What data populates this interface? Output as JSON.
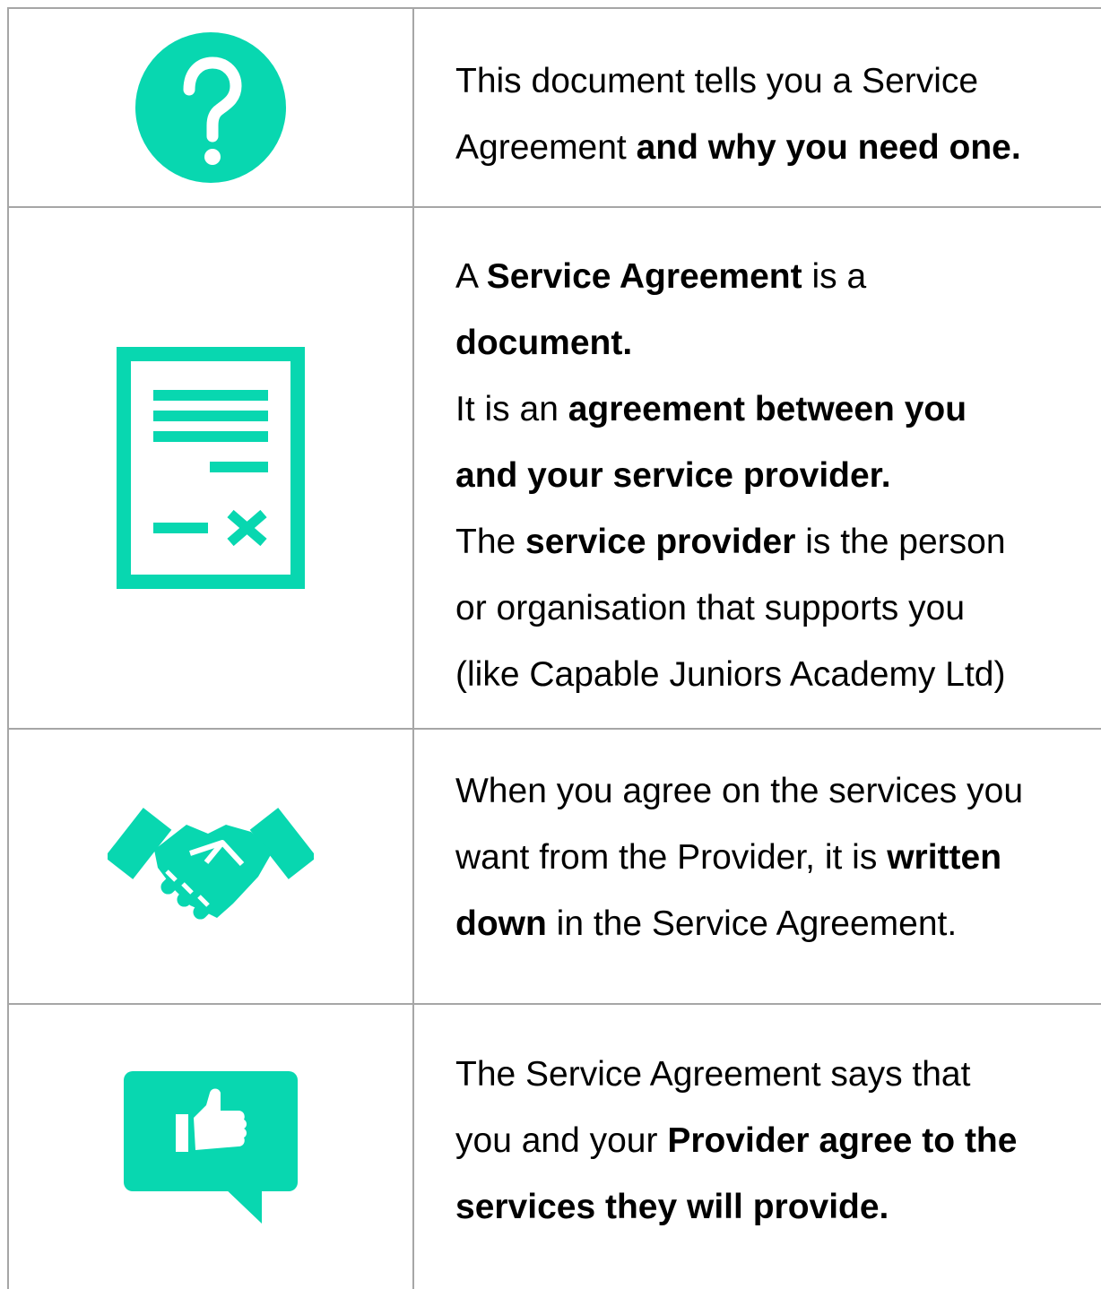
{
  "accent_color": "#08d7b0",
  "rows": [
    {
      "icon": "question-mark-icon",
      "lines": [
        [
          {
            "t": "This document tells you a Service",
            "b": false
          }
        ],
        [
          {
            "t": "Agreement ",
            "b": false
          },
          {
            "t": "and why you need one.",
            "b": true
          }
        ]
      ]
    },
    {
      "icon": "document-sign-icon",
      "lines": [
        [
          {
            "t": "A ",
            "b": false
          },
          {
            "t": "Service Agreement",
            "b": true
          },
          {
            "t": " is a",
            "b": false
          }
        ],
        [
          {
            "t": "document.",
            "b": true
          }
        ],
        [
          {
            "t": "It is an ",
            "b": false
          },
          {
            "t": "agreement between you",
            "b": true
          }
        ],
        [
          {
            "t": "and your service provider.",
            "b": true
          }
        ],
        [
          {
            "t": "The ",
            "b": false
          },
          {
            "t": "service provider",
            "b": true
          },
          {
            "t": " is the person",
            "b": false
          }
        ],
        [
          {
            "t": "or organisation that supports you",
            "b": false
          }
        ],
        [
          {
            "t": "(like Capable Juniors Academy Ltd)",
            "b": false
          }
        ]
      ]
    },
    {
      "icon": "handshake-icon",
      "lines": [
        [
          {
            "t": "When you agree on the services you",
            "b": false
          }
        ],
        [
          {
            "t": "want from the Provider, it is ",
            "b": false
          },
          {
            "t": "written",
            "b": true
          }
        ],
        [
          {
            "t": "down",
            "b": true
          },
          {
            "t": " in the Service Agreement.",
            "b": false
          }
        ]
      ]
    },
    {
      "icon": "thumbs-up-speech-bubble-icon",
      "lines": [
        [
          {
            "t": "The Service Agreement says that",
            "b": false
          }
        ],
        [
          {
            "t": "you and your ",
            "b": false
          },
          {
            "t": "Provider agree to the",
            "b": true
          }
        ],
        [
          {
            "t": "services they will provide.",
            "b": true
          }
        ]
      ]
    }
  ]
}
